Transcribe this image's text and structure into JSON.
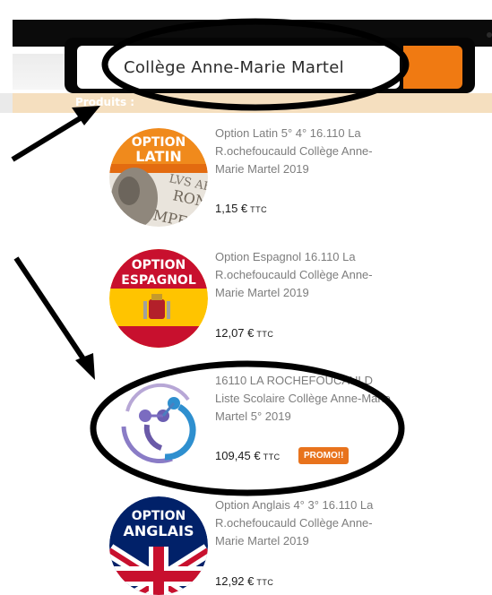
{
  "search": {
    "value": "Collège Anne-Marie Martel"
  },
  "subbar": {
    "label": "Produits :"
  },
  "products": [
    {
      "title": "Option Latin 5° 4° 16.110 La R.ochefoucauld Collège Anne-Marie Martel 2019",
      "price": "1,15 €",
      "ttc": "TTC",
      "badge_top": "OPTION",
      "badge_bottom": "LATIN",
      "stone_text": "LVS AEM\n RONY\nMPE"
    },
    {
      "title": "Option Espagnol 16.110 La R.ochefoucauld Collège Anne-Marie Martel 2019",
      "price": "12,07 €",
      "ttc": "TTC",
      "badge_top": "OPTION",
      "badge_bottom": "ESPAGNOL"
    },
    {
      "title": "16110 LA ROCHEFOUCAULD Liste Scolaire Collège Anne-Marie Martel 5° 2019",
      "price": "109,45 €",
      "ttc": "TTC",
      "promo": "PROMO!!"
    },
    {
      "title": "Option Anglais 4° 3° 16.110 La R.ochefoucauld Collège Anne-Marie Martel 2019",
      "price": "12,92 €",
      "ttc": "TTC",
      "badge_top": "OPTION",
      "badge_bottom": "ANGLAIS"
    }
  ],
  "colors": {
    "accent": "#f07a12",
    "subbar": "#f5dfbf",
    "spain_red": "#c8102e",
    "spain_yellow": "#ffc400",
    "uk_blue": "#012169"
  }
}
